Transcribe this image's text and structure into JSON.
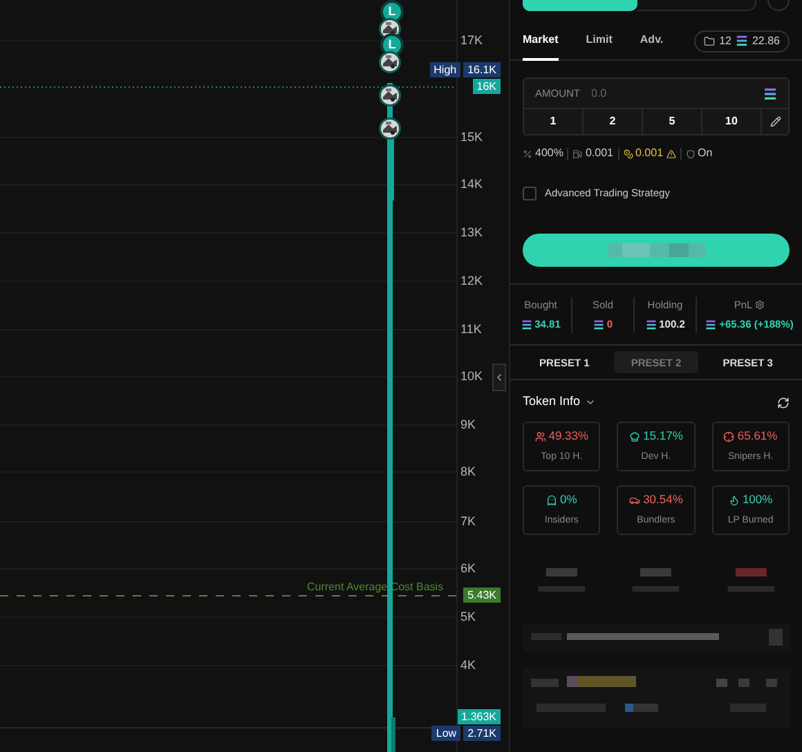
{
  "chart": {
    "markers": [
      {
        "kind": "letter",
        "label": "L"
      },
      {
        "kind": "picture"
      },
      {
        "kind": "letter",
        "label": "L"
      },
      {
        "kind": "picture"
      },
      {
        "kind": "picture"
      },
      {
        "kind": "picture"
      }
    ],
    "price_axis": [
      "17K",
      "15K",
      "14K",
      "13K",
      "12K",
      "11K",
      "10K",
      "9K",
      "8K",
      "7K",
      "6K",
      "5K",
      "4K"
    ],
    "price_tags": [
      {
        "kind": "high",
        "label": "High",
        "value": "16.1K"
      },
      {
        "kind": "current",
        "value": "16K"
      },
      {
        "kind": "cost_basis",
        "value": "5.43K"
      },
      {
        "kind": "last",
        "value": "1.363K"
      },
      {
        "kind": "low",
        "label": "Low",
        "value": "2.71K"
      }
    ],
    "cost_basis_line": {
      "label": "Current Average Cost Basis"
    }
  },
  "order_tabs": [
    {
      "label": "Market",
      "selected": true
    },
    {
      "label": "Limit",
      "selected": false
    },
    {
      "label": "Adv.",
      "selected": false
    }
  ],
  "wallet": {
    "count": "12",
    "balance": "22.86"
  },
  "amount": {
    "label": "AMOUNT",
    "placeholder": "0.0"
  },
  "quick_amounts": [
    "1",
    "2",
    "5",
    "10"
  ],
  "settings": [
    {
      "kind": "slippage",
      "value": "400%",
      "warning": false
    },
    {
      "kind": "priority",
      "value": "0.001",
      "warning": false
    },
    {
      "kind": "bribe",
      "value": "0.001",
      "warning": true
    },
    {
      "kind": "mev",
      "value": "On",
      "warning": false
    }
  ],
  "advanced_strategy": {
    "label": "Advanced Trading Strategy",
    "checked": false
  },
  "stats": [
    {
      "kind": "plain",
      "label": "Bought",
      "value": "34.81",
      "color": "#2fd3b0"
    },
    {
      "kind": "plain",
      "label": "Sold",
      "value": "0",
      "color": "#f0605d"
    },
    {
      "kind": "plain",
      "label": "Holding",
      "value": "100.2",
      "color": "#e5e5e5"
    },
    {
      "kind": "pnl",
      "label": "PnL",
      "value": "+65.36 (+188%)",
      "color": "#2fd3b0"
    }
  ],
  "presets": [
    {
      "label": "PRESET 1",
      "selected": false
    },
    {
      "label": "PRESET 2",
      "selected": true
    },
    {
      "label": "PRESET 3",
      "selected": false
    }
  ],
  "token_info": {
    "title": "Token Info",
    "metrics": [
      {
        "kind": "top10",
        "value": "49.33%",
        "label": "Top 10 H.",
        "color": "#f0605d"
      },
      {
        "kind": "dev",
        "value": "15.17%",
        "label": "Dev H.",
        "color": "#2fd3b0"
      },
      {
        "kind": "snipers",
        "value": "65.61%",
        "label": "Snipers H.",
        "color": "#f0605d"
      },
      {
        "kind": "insiders",
        "value": "0%",
        "label": "Insiders",
        "color": "#2fd3b0"
      },
      {
        "kind": "bundlers",
        "value": "30.54%",
        "label": "Bundlers",
        "color": "#f0605d"
      },
      {
        "kind": "lp",
        "value": "100%",
        "label": "LP Burned",
        "color": "#2fd3b0"
      }
    ]
  }
}
